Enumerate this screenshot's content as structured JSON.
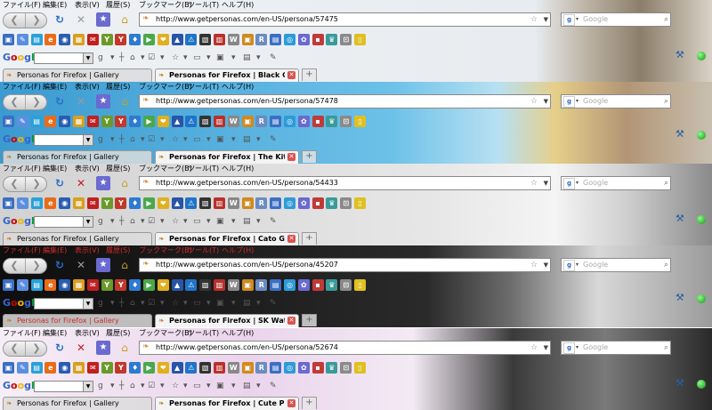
{
  "menu": [
    "ファイル(F)",
    "編集(E)",
    "表示(V)",
    "履歴(S)",
    "ブックマーク(B)",
    "ツール(T)",
    "ヘルプ(H)"
  ],
  "search_placeholder": "Google",
  "google_logo": "Google",
  "gallery_tab": "Personas for Firefox | Gallery",
  "new_tab_label": "+",
  "icons": {
    "back": "back-arrow-icon",
    "forward": "forward-arrow-icon",
    "reload": "reload-icon",
    "stop": "stop-icon",
    "home": "home-icon",
    "bookmark_star": "bookmark-star-icon",
    "wrench": "wrench-icon",
    "status": "status-dot-icon"
  },
  "strips": [
    {
      "url": "http://www.getpersonas.com/en-US/persona/57475",
      "active_tab": "Personas for Firefox | Black C...",
      "colors": {
        "bg": "#e9edf2",
        "menu_text": "#000000",
        "tab_text": "#000000"
      }
    },
    {
      "url": "http://www.getpersonas.com/en-US/persona/57478",
      "active_tab": "Personas for Firefox | The Kitt...",
      "colors": {
        "bg": "#5aaed8",
        "menu_text": "#000000",
        "tab_text": "#000000"
      }
    },
    {
      "url": "http://www.getpersonas.com/en-US/persona/54433",
      "active_tab": "Personas for Firefox | Cato Gi...",
      "colors": {
        "bg": "#d8d8d8",
        "menu_text": "#000000",
        "tab_text": "#000000"
      }
    },
    {
      "url": "http://www.getpersonas.com/en-US/persona/45207",
      "active_tab": "Personas for Firefox | SK Watc...",
      "colors": {
        "bg": "#1a1a1a",
        "menu_text": "#d12a2a",
        "tab_text": "#d12a2a"
      }
    },
    {
      "url": "http://www.getpersonas.com/en-US/persona/52674",
      "active_tab": "Personas for Firefox | Cute Pu...",
      "colors": {
        "bg": "#f2eaf4",
        "menu_text": "#000000",
        "tab_text": "#000000"
      }
    }
  ]
}
